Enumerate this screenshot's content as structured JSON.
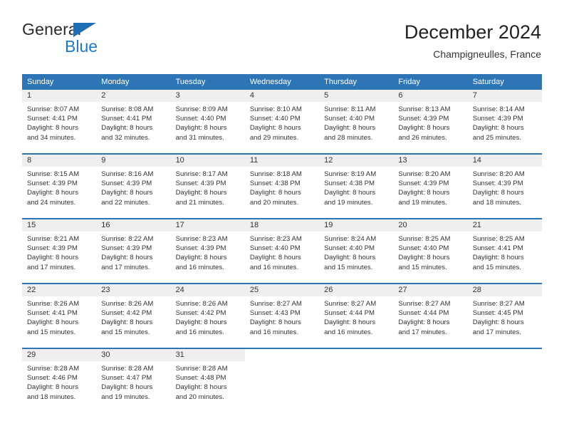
{
  "logo": {
    "primary_text": "General",
    "secondary_text": "Blue",
    "triangle_icon": "blue-triangle-icon",
    "accent_color": "#1f7ac4"
  },
  "header": {
    "title": "December 2024",
    "subtitle": "Champigneulles, France"
  },
  "colors": {
    "header_row": "#2e75b6",
    "daynum_band": "#efefef",
    "text": "#333333"
  },
  "calendar": {
    "weekday_headers": [
      "Sunday",
      "Monday",
      "Tuesday",
      "Wednesday",
      "Thursday",
      "Friday",
      "Saturday"
    ],
    "weeks": [
      [
        {
          "day": "1",
          "sunrise": "Sunrise: 8:07 AM",
          "sunset": "Sunset: 4:41 PM",
          "daylight_line1": "Daylight: 8 hours",
          "daylight_line2": "and 34 minutes."
        },
        {
          "day": "2",
          "sunrise": "Sunrise: 8:08 AM",
          "sunset": "Sunset: 4:41 PM",
          "daylight_line1": "Daylight: 8 hours",
          "daylight_line2": "and 32 minutes."
        },
        {
          "day": "3",
          "sunrise": "Sunrise: 8:09 AM",
          "sunset": "Sunset: 4:40 PM",
          "daylight_line1": "Daylight: 8 hours",
          "daylight_line2": "and 31 minutes."
        },
        {
          "day": "4",
          "sunrise": "Sunrise: 8:10 AM",
          "sunset": "Sunset: 4:40 PM",
          "daylight_line1": "Daylight: 8 hours",
          "daylight_line2": "and 29 minutes."
        },
        {
          "day": "5",
          "sunrise": "Sunrise: 8:11 AM",
          "sunset": "Sunset: 4:40 PM",
          "daylight_line1": "Daylight: 8 hours",
          "daylight_line2": "and 28 minutes."
        },
        {
          "day": "6",
          "sunrise": "Sunrise: 8:13 AM",
          "sunset": "Sunset: 4:39 PM",
          "daylight_line1": "Daylight: 8 hours",
          "daylight_line2": "and 26 minutes."
        },
        {
          "day": "7",
          "sunrise": "Sunrise: 8:14 AM",
          "sunset": "Sunset: 4:39 PM",
          "daylight_line1": "Daylight: 8 hours",
          "daylight_line2": "and 25 minutes."
        }
      ],
      [
        {
          "day": "8",
          "sunrise": "Sunrise: 8:15 AM",
          "sunset": "Sunset: 4:39 PM",
          "daylight_line1": "Daylight: 8 hours",
          "daylight_line2": "and 24 minutes."
        },
        {
          "day": "9",
          "sunrise": "Sunrise: 8:16 AM",
          "sunset": "Sunset: 4:39 PM",
          "daylight_line1": "Daylight: 8 hours",
          "daylight_line2": "and 22 minutes."
        },
        {
          "day": "10",
          "sunrise": "Sunrise: 8:17 AM",
          "sunset": "Sunset: 4:39 PM",
          "daylight_line1": "Daylight: 8 hours",
          "daylight_line2": "and 21 minutes."
        },
        {
          "day": "11",
          "sunrise": "Sunrise: 8:18 AM",
          "sunset": "Sunset: 4:38 PM",
          "daylight_line1": "Daylight: 8 hours",
          "daylight_line2": "and 20 minutes."
        },
        {
          "day": "12",
          "sunrise": "Sunrise: 8:19 AM",
          "sunset": "Sunset: 4:38 PM",
          "daylight_line1": "Daylight: 8 hours",
          "daylight_line2": "and 19 minutes."
        },
        {
          "day": "13",
          "sunrise": "Sunrise: 8:20 AM",
          "sunset": "Sunset: 4:39 PM",
          "daylight_line1": "Daylight: 8 hours",
          "daylight_line2": "and 19 minutes."
        },
        {
          "day": "14",
          "sunrise": "Sunrise: 8:20 AM",
          "sunset": "Sunset: 4:39 PM",
          "daylight_line1": "Daylight: 8 hours",
          "daylight_line2": "and 18 minutes."
        }
      ],
      [
        {
          "day": "15",
          "sunrise": "Sunrise: 8:21 AM",
          "sunset": "Sunset: 4:39 PM",
          "daylight_line1": "Daylight: 8 hours",
          "daylight_line2": "and 17 minutes."
        },
        {
          "day": "16",
          "sunrise": "Sunrise: 8:22 AM",
          "sunset": "Sunset: 4:39 PM",
          "daylight_line1": "Daylight: 8 hours",
          "daylight_line2": "and 17 minutes."
        },
        {
          "day": "17",
          "sunrise": "Sunrise: 8:23 AM",
          "sunset": "Sunset: 4:39 PM",
          "daylight_line1": "Daylight: 8 hours",
          "daylight_line2": "and 16 minutes."
        },
        {
          "day": "18",
          "sunrise": "Sunrise: 8:23 AM",
          "sunset": "Sunset: 4:40 PM",
          "daylight_line1": "Daylight: 8 hours",
          "daylight_line2": "and 16 minutes."
        },
        {
          "day": "19",
          "sunrise": "Sunrise: 8:24 AM",
          "sunset": "Sunset: 4:40 PM",
          "daylight_line1": "Daylight: 8 hours",
          "daylight_line2": "and 15 minutes."
        },
        {
          "day": "20",
          "sunrise": "Sunrise: 8:25 AM",
          "sunset": "Sunset: 4:40 PM",
          "daylight_line1": "Daylight: 8 hours",
          "daylight_line2": "and 15 minutes."
        },
        {
          "day": "21",
          "sunrise": "Sunrise: 8:25 AM",
          "sunset": "Sunset: 4:41 PM",
          "daylight_line1": "Daylight: 8 hours",
          "daylight_line2": "and 15 minutes."
        }
      ],
      [
        {
          "day": "22",
          "sunrise": "Sunrise: 8:26 AM",
          "sunset": "Sunset: 4:41 PM",
          "daylight_line1": "Daylight: 8 hours",
          "daylight_line2": "and 15 minutes."
        },
        {
          "day": "23",
          "sunrise": "Sunrise: 8:26 AM",
          "sunset": "Sunset: 4:42 PM",
          "daylight_line1": "Daylight: 8 hours",
          "daylight_line2": "and 15 minutes."
        },
        {
          "day": "24",
          "sunrise": "Sunrise: 8:26 AM",
          "sunset": "Sunset: 4:42 PM",
          "daylight_line1": "Daylight: 8 hours",
          "daylight_line2": "and 16 minutes."
        },
        {
          "day": "25",
          "sunrise": "Sunrise: 8:27 AM",
          "sunset": "Sunset: 4:43 PM",
          "daylight_line1": "Daylight: 8 hours",
          "daylight_line2": "and 16 minutes."
        },
        {
          "day": "26",
          "sunrise": "Sunrise: 8:27 AM",
          "sunset": "Sunset: 4:44 PM",
          "daylight_line1": "Daylight: 8 hours",
          "daylight_line2": "and 16 minutes."
        },
        {
          "day": "27",
          "sunrise": "Sunrise: 8:27 AM",
          "sunset": "Sunset: 4:44 PM",
          "daylight_line1": "Daylight: 8 hours",
          "daylight_line2": "and 17 minutes."
        },
        {
          "day": "28",
          "sunrise": "Sunrise: 8:27 AM",
          "sunset": "Sunset: 4:45 PM",
          "daylight_line1": "Daylight: 8 hours",
          "daylight_line2": "and 17 minutes."
        }
      ],
      [
        {
          "day": "29",
          "sunrise": "Sunrise: 8:28 AM",
          "sunset": "Sunset: 4:46 PM",
          "daylight_line1": "Daylight: 8 hours",
          "daylight_line2": "and 18 minutes."
        },
        {
          "day": "30",
          "sunrise": "Sunrise: 8:28 AM",
          "sunset": "Sunset: 4:47 PM",
          "daylight_line1": "Daylight: 8 hours",
          "daylight_line2": "and 19 minutes."
        },
        {
          "day": "31",
          "sunrise": "Sunrise: 8:28 AM",
          "sunset": "Sunset: 4:48 PM",
          "daylight_line1": "Daylight: 8 hours",
          "daylight_line2": "and 20 minutes."
        },
        {
          "day": "",
          "sunrise": "",
          "sunset": "",
          "daylight_line1": "",
          "daylight_line2": ""
        },
        {
          "day": "",
          "sunrise": "",
          "sunset": "",
          "daylight_line1": "",
          "daylight_line2": ""
        },
        {
          "day": "",
          "sunrise": "",
          "sunset": "",
          "daylight_line1": "",
          "daylight_line2": ""
        },
        {
          "day": "",
          "sunrise": "",
          "sunset": "",
          "daylight_line1": "",
          "daylight_line2": ""
        }
      ]
    ]
  }
}
